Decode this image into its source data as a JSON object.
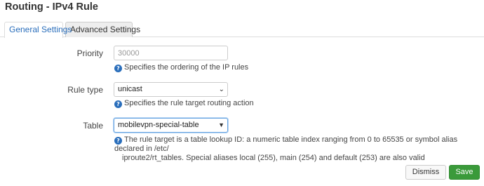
{
  "dialog": {
    "title": "Routing - IPv4 Rule"
  },
  "tabs": [
    {
      "label": "General Settings",
      "active": true
    },
    {
      "label": "Advanced Settings",
      "active": false
    }
  ],
  "fields": {
    "priority": {
      "label": "Priority",
      "placeholder": "30000",
      "value": "",
      "help": "Specifies the ordering of the IP rules"
    },
    "rule_type": {
      "label": "Rule type",
      "value": "unicast",
      "help": "Specifies the rule target routing action"
    },
    "table": {
      "label": "Table",
      "value": "mobilevpn-special-table",
      "help_line1": "The rule target is a table lookup ID: a numeric table index ranging from 0 to 65535 or symbol alias declared in /etc/",
      "help_line2": "iproute2/rt_tables. Special aliases local (255), main (254) and default (253) are also valid"
    }
  },
  "buttons": {
    "dismiss": "Dismiss",
    "save": "Save"
  },
  "icons": {
    "help": "help-icon",
    "rule_type_chevron": "chevron-down-icon",
    "table_arrow": "caret-down-icon"
  },
  "colors": {
    "accent": "#2a6ebb",
    "save": "#3a9a3a"
  }
}
